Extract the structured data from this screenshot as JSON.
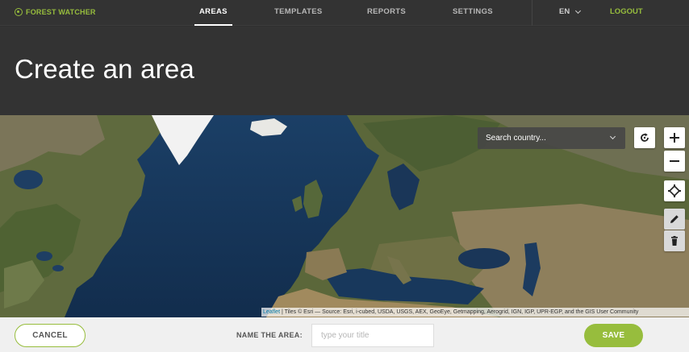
{
  "app": {
    "logo_text": "FOREST WATCHER",
    "brand_color": "#97bd3d"
  },
  "nav": {
    "tabs": [
      {
        "label": "AREAS",
        "active": true
      },
      {
        "label": "TEMPLATES",
        "active": false
      },
      {
        "label": "REPORTS",
        "active": false
      },
      {
        "label": "SETTINGS",
        "active": false
      }
    ],
    "language": "EN",
    "logout_label": "LOGOUT"
  },
  "header": {
    "title": "Create an area"
  },
  "map": {
    "search_placeholder": "Search country...",
    "controls": [
      "refresh-icon",
      "zoom-in-icon",
      "zoom-out-icon",
      "locate-icon",
      "pencil-icon",
      "trash-icon"
    ],
    "attribution_link": "Leaflet",
    "attribution_text": " | Tiles © Esri — Source: Esri, i-cubed, USDA, USGS, AEX, GeoEye, Getmapping, Aerogrid, IGN, IGP, UPR-EGP, and the GIS User Community"
  },
  "footer": {
    "cancel_label": "CANCEL",
    "name_label": "NAME THE AREA:",
    "name_placeholder": "type your title",
    "name_value": "",
    "save_label": "SAVE"
  }
}
